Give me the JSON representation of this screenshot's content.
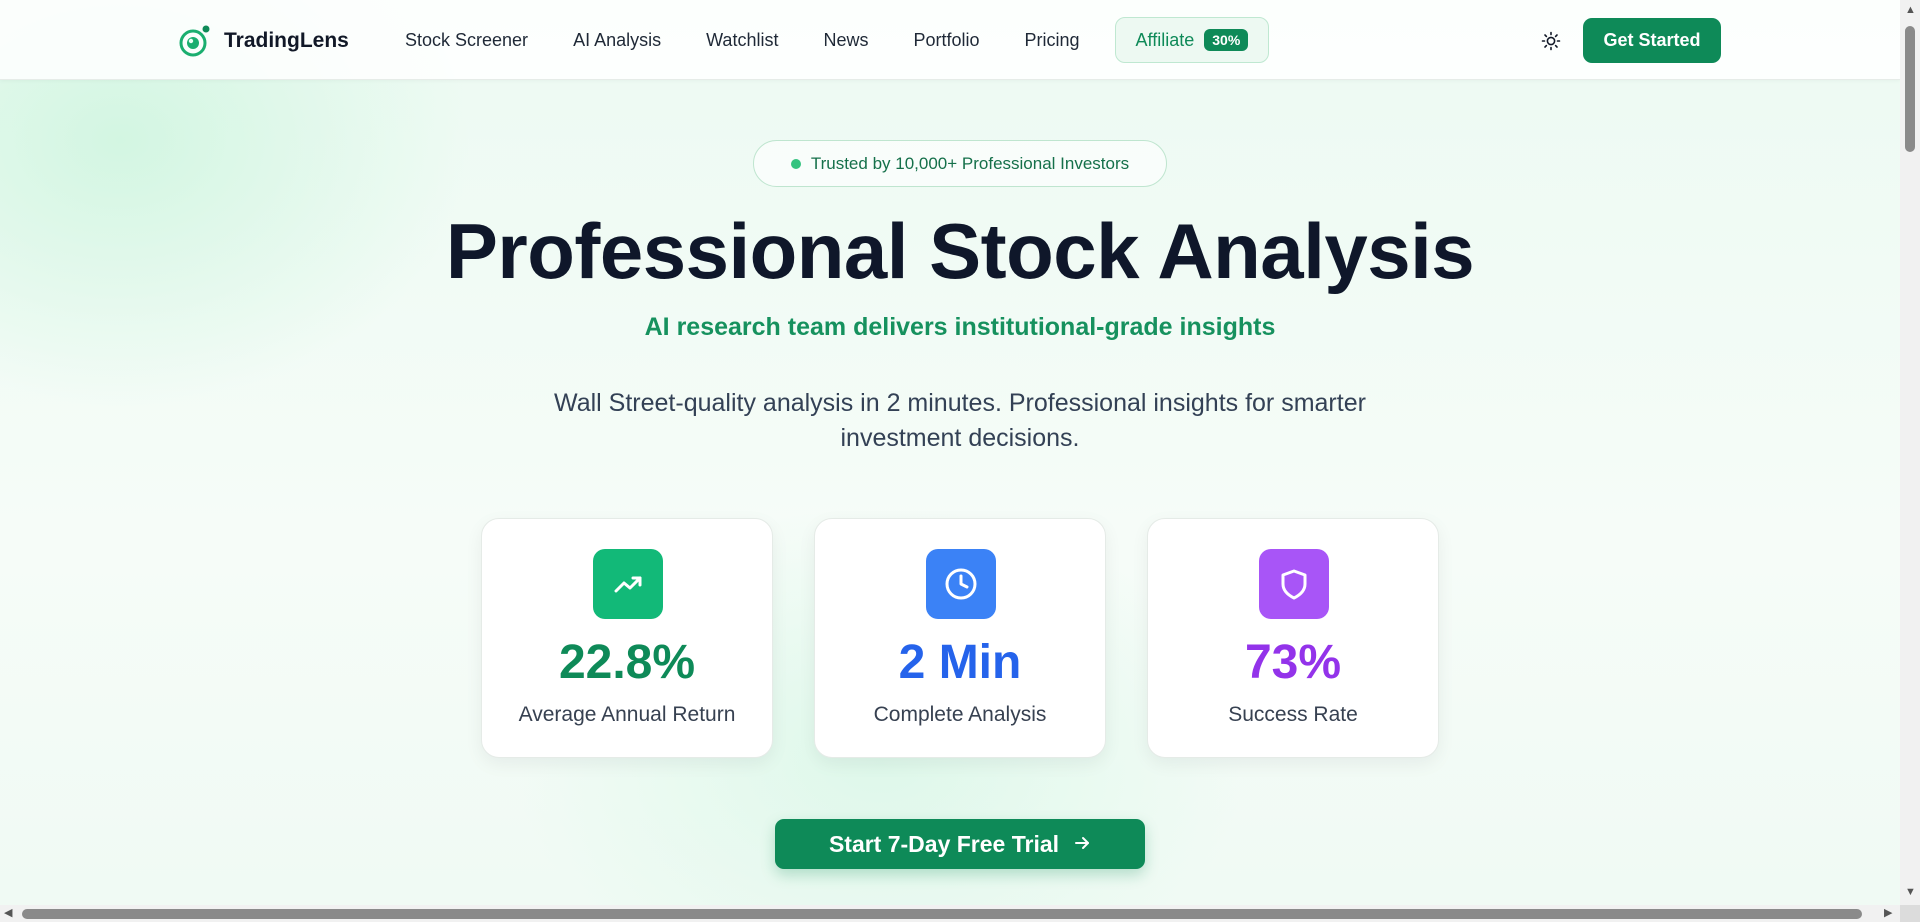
{
  "nav": {
    "brand": "TradingLens",
    "links": [
      "Stock Screener",
      "AI Analysis",
      "Watchlist",
      "News",
      "Portfolio",
      "Pricing"
    ],
    "affiliate_label": "Affiliate",
    "affiliate_badge": "30%",
    "theme_icon": "sun-icon",
    "get_started": "Get Started"
  },
  "hero": {
    "trust_badge": "Trusted by 10,000+ Professional Investors",
    "title": "Professional Stock Analysis",
    "subtitle": "AI research team delivers institutional-grade insights",
    "description": "Wall Street-quality analysis in 2 minutes. Professional insights for smarter investment decisions."
  },
  "stats": [
    {
      "value": "22.8%",
      "label": "Average Annual Return",
      "icon": "trending-up-icon",
      "color": "#0e8a58",
      "icon_bg": "#12b978"
    },
    {
      "value": "2 Min",
      "label": "Complete Analysis",
      "icon": "clock-icon",
      "color": "#2563eb",
      "icon_bg": "#3b82f6"
    },
    {
      "value": "73%",
      "label": "Success Rate",
      "icon": "shield-icon",
      "color": "#9333ea",
      "icon_bg": "#a855f7"
    }
  ],
  "cta": {
    "label": "Start 7-Day Free Trial",
    "icon": "arrow-right-icon"
  },
  "colors": {
    "brand": "#0e8a58",
    "accent": "#16915e",
    "text": "#0f172a"
  }
}
